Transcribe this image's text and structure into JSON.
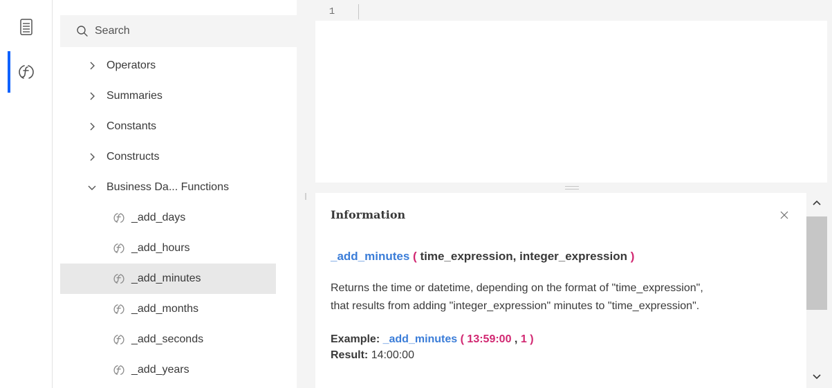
{
  "rail": {
    "items": [
      {
        "icon": "data-list-icon"
      },
      {
        "icon": "function-icon",
        "active": true
      }
    ]
  },
  "search": {
    "placeholder": "Search"
  },
  "tree": {
    "groups": [
      {
        "label": "Operators",
        "expanded": false
      },
      {
        "label": "Summaries",
        "expanded": false
      },
      {
        "label": "Constants",
        "expanded": false
      },
      {
        "label": "Constructs",
        "expanded": false
      },
      {
        "label": "Business Da... Functions",
        "expanded": true
      }
    ],
    "functions": [
      {
        "label": "_add_days"
      },
      {
        "label": "_add_hours"
      },
      {
        "label": "_add_minutes",
        "selected": true
      },
      {
        "label": "_add_months"
      },
      {
        "label": "_add_seconds"
      },
      {
        "label": "_add_years"
      }
    ]
  },
  "editor": {
    "line_number": "1"
  },
  "info": {
    "title": "Information",
    "signature": {
      "name": "_add_minutes",
      "open": "(",
      "param1": "time_expression,",
      "param2": "integer_expression",
      "close": ")"
    },
    "description_line1": "Returns the time or datetime, depending on the format of \"time_expression\",",
    "description_line2": "that results from adding \"integer_expression\" minutes to \"time_expression\".",
    "example": {
      "label": "Example:",
      "name": "_add_minutes",
      "open": "(",
      "arg1": "13:59:00",
      "sep": ",",
      "arg2": "1",
      "close": ")"
    },
    "result": {
      "label": "Result:",
      "value": "14:00:00"
    }
  },
  "colors": {
    "accent": "#0f62fe",
    "function_name": "#3b7dd8",
    "paren": "#d12771",
    "selected_row": "#e8e8e8"
  }
}
